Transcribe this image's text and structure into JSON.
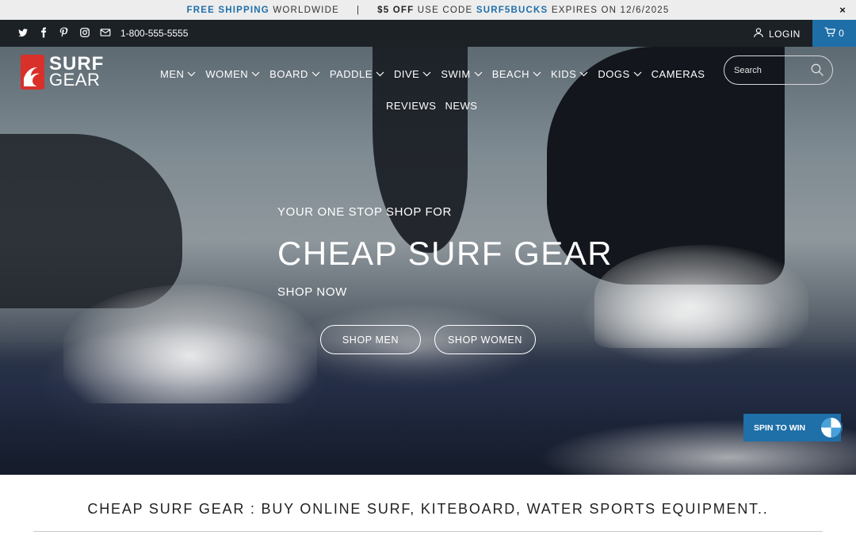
{
  "announcement": {
    "part1_bold": "FREE SHIPPING",
    "part1_rest": "WORLDWIDE",
    "separator": "|",
    "part2_bold": "$5 OFF",
    "part2_mid": "USE CODE",
    "part2_code": "SURF5BUCKS",
    "part2_rest": "EXPIRES ON 12/6/2025",
    "close_glyph": "×"
  },
  "topbar": {
    "social_icons": [
      "twitter-icon",
      "facebook-icon",
      "pinterest-icon",
      "instagram-icon",
      "email-icon"
    ],
    "phone": "1-800-555-5555",
    "login_label": "LOGIN",
    "cart_count": "0",
    "cart_color": "#1e6fa8"
  },
  "header": {
    "logo_word_1": "SURF",
    "logo_word_2": "GEAR",
    "nav": [
      {
        "label": "MEN"
      },
      {
        "label": "WOMEN"
      },
      {
        "label": "BOARD"
      },
      {
        "label": "PADDLE"
      },
      {
        "label": "DIVE"
      },
      {
        "label": "SWIM"
      },
      {
        "label": "BEACH"
      },
      {
        "label": "KIDS"
      },
      {
        "label": "DOGS"
      },
      {
        "label": "CAMERAS"
      }
    ],
    "nav_row2": [
      "REVIEWS",
      "NEWS"
    ],
    "search_placeholder": "Search"
  },
  "hero": {
    "eyebrow": "YOUR ONE STOP SHOP FOR",
    "headline": "CHEAP SURF GEAR",
    "subtext": "SHOP NOW",
    "button_men": "SHOP MEN",
    "button_women": "SHOP WOMEN"
  },
  "spin_widget": {
    "label": "SPIN TO WIN",
    "color": "#1f6fa8"
  },
  "main": {
    "tagline": "CHEAP SURF GEAR : BUY ONLINE SURF, KITEBOARD, WATER SPORTS EQUIPMENT.."
  }
}
